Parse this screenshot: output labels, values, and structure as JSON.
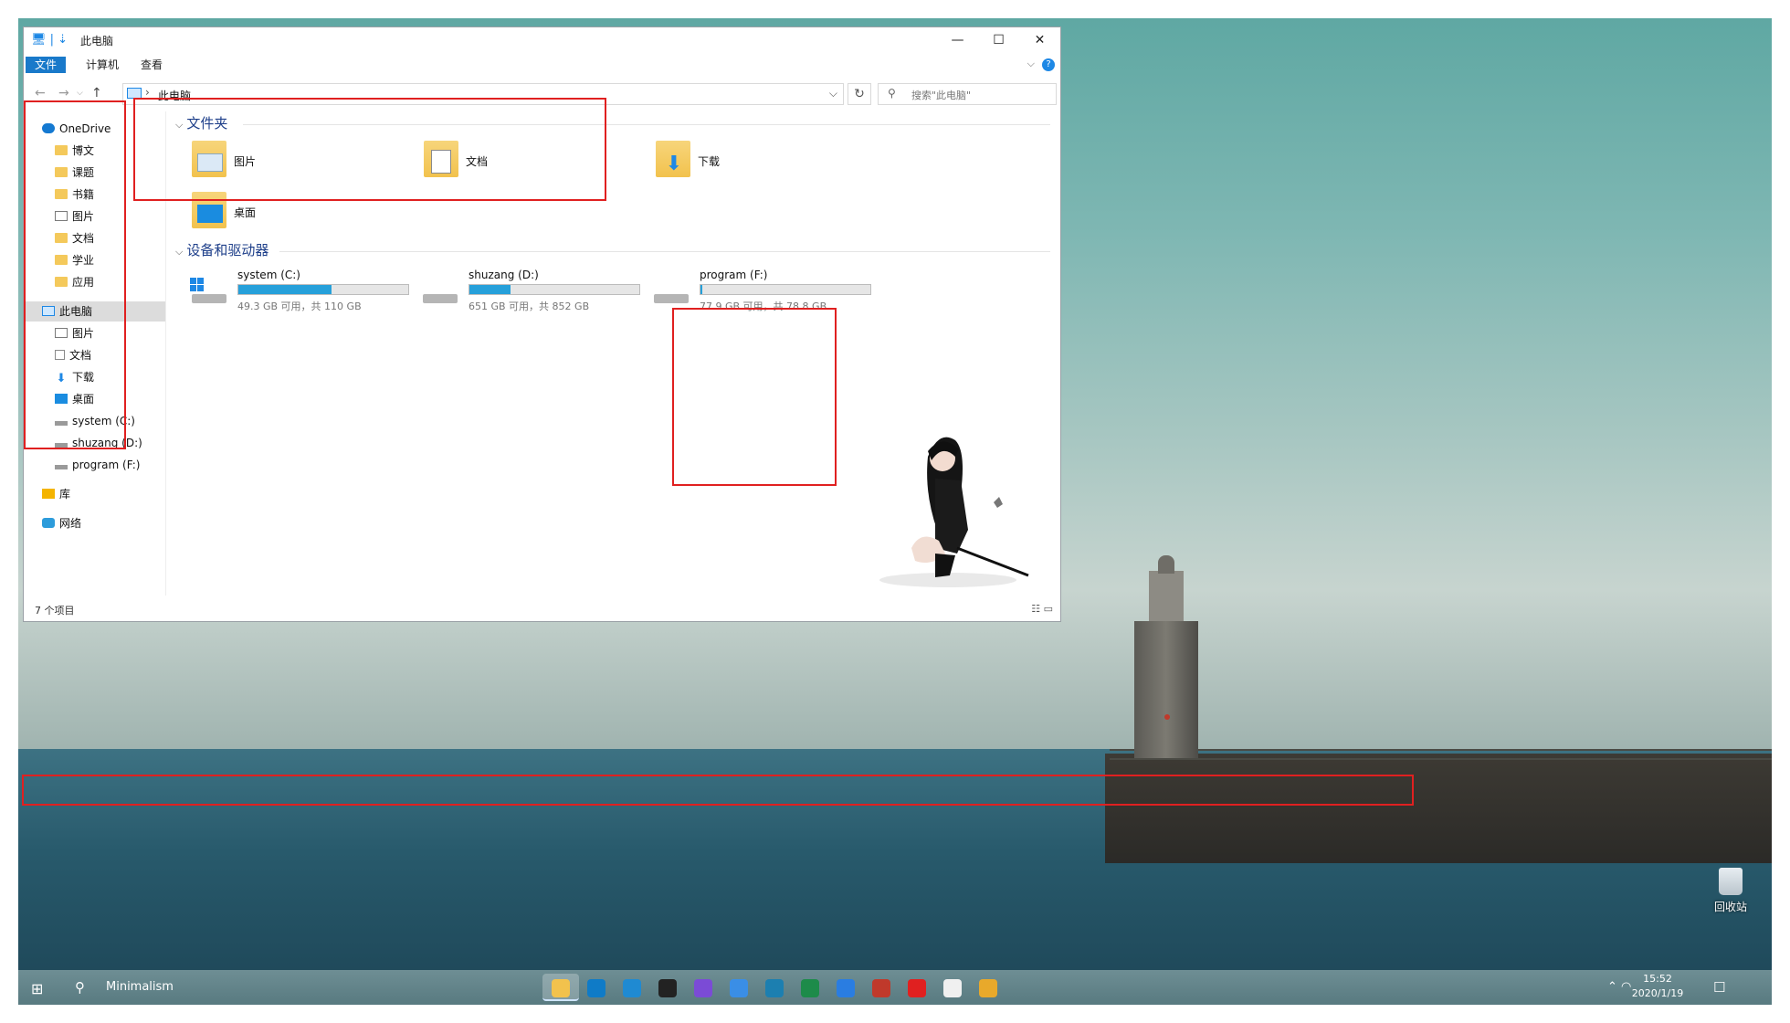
{
  "window": {
    "title": "此电脑",
    "ribbon_tabs": [
      "文件",
      "计算机",
      "查看"
    ],
    "address": "此电脑",
    "search_placeholder": "搜索\"此电脑\"",
    "status": "7 个项目"
  },
  "sidebar": {
    "items": [
      {
        "label": "OneDrive",
        "icon": "cloud-icon"
      },
      {
        "label": "博文",
        "icon": "folder-icon"
      },
      {
        "label": "课题",
        "icon": "folder-icon"
      },
      {
        "label": "书籍",
        "icon": "folder-icon"
      },
      {
        "label": "图片",
        "icon": "pictures-icon"
      },
      {
        "label": "文档",
        "icon": "folder-icon"
      },
      {
        "label": "学业",
        "icon": "folder-icon"
      },
      {
        "label": "应用",
        "icon": "folder-icon"
      },
      {
        "label": "此电脑",
        "icon": "computer-icon",
        "selected": true
      },
      {
        "label": "图片",
        "icon": "pictures-icon"
      },
      {
        "label": "文档",
        "icon": "documents-icon"
      },
      {
        "label": "下载",
        "icon": "download-icon"
      },
      {
        "label": "桌面",
        "icon": "desktop-icon"
      },
      {
        "label": "system (C:)",
        "icon": "drive-icon"
      },
      {
        "label": "shuzang (D:)",
        "icon": "drive-icon"
      },
      {
        "label": "program (F:)",
        "icon": "drive-icon"
      },
      {
        "label": "库",
        "icon": "library-icon"
      },
      {
        "label": "网络",
        "icon": "network-icon"
      }
    ]
  },
  "folders": {
    "heading": "文件夹",
    "items": [
      {
        "label": "图片",
        "icon": "pictures-folder-icon"
      },
      {
        "label": "文档",
        "icon": "documents-folder-icon"
      },
      {
        "label": "下载",
        "icon": "downloads-folder-icon"
      },
      {
        "label": "桌面",
        "icon": "desktop-folder-icon"
      }
    ]
  },
  "drives": {
    "heading": "设备和驱动器",
    "items": [
      {
        "name": "system (C:)",
        "size": "49.3 GB 可用，共 110 GB",
        "used_fraction": 0.55
      },
      {
        "name": "shuzang (D:)",
        "size": "651 GB 可用，共 852 GB",
        "used_fraction": 0.24
      },
      {
        "name": "program (F:)",
        "size": "77.9 GB 可用，共 78.8 GB",
        "used_fraction": 0.01
      }
    ]
  },
  "desktop": {
    "recycle_bin": "回收站"
  },
  "taskbar": {
    "search_text": "Minimalism",
    "apps": [
      {
        "name": "file-explorer",
        "color": "#f2c24d"
      },
      {
        "name": "edge",
        "color": "#0f7bc7"
      },
      {
        "name": "vscode",
        "color": "#1f8ad2"
      },
      {
        "name": "qq",
        "color": "#222222"
      },
      {
        "name": "app-purple",
        "color": "#7b4bd6"
      },
      {
        "name": "app-bird",
        "color": "#3a8ee6"
      },
      {
        "name": "app-s",
        "color": "#1c7fb0"
      },
      {
        "name": "app-u",
        "color": "#1d8b4a"
      },
      {
        "name": "todo",
        "color": "#2a7de1"
      },
      {
        "name": "app-red",
        "color": "#c0392b"
      },
      {
        "name": "netease-music",
        "color": "#e02020"
      },
      {
        "name": "typora",
        "color": "#f0f0f0"
      },
      {
        "name": "app-multicolor",
        "color": "#e8a92b"
      }
    ],
    "time": "15:52",
    "date": "2020/1/19"
  }
}
